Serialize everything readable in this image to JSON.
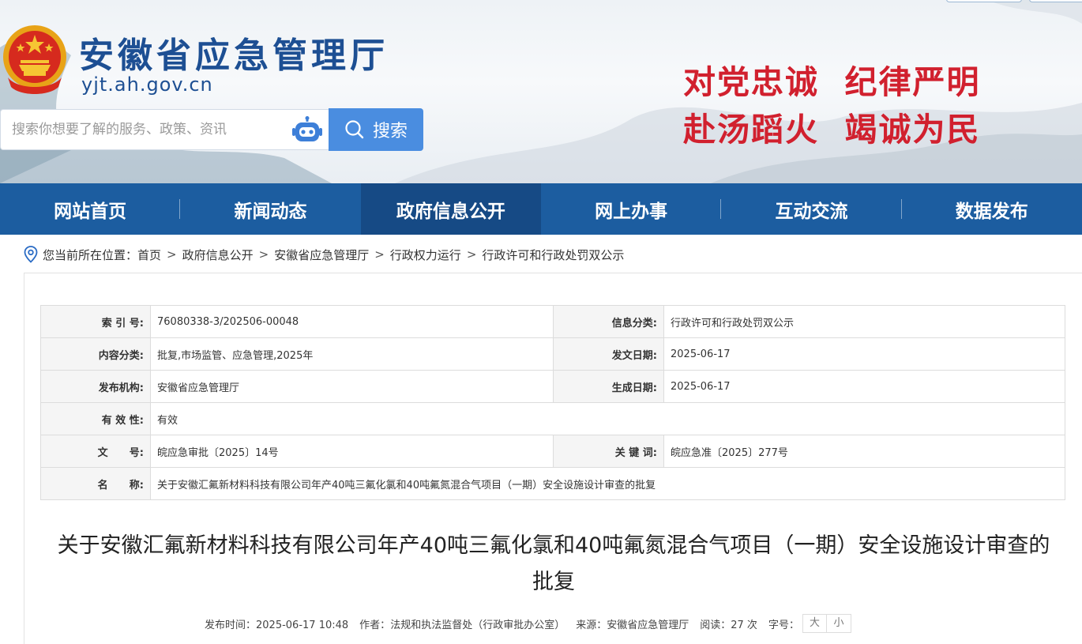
{
  "header": {
    "site_title": "安徽省应急管理厅",
    "site_domain": "yjt.ah.gov.cn",
    "slogan_line1": "对党忠诚  纪律严明",
    "slogan_line2": "赴汤蹈火  竭诚为民",
    "search_placeholder": "搜索你想要了解的服务、政策、资讯",
    "search_button": "搜索",
    "colors": {
      "title": "#1d4f93",
      "slogan": "#d1202e",
      "search_button": "#4a8de0"
    }
  },
  "nav": {
    "items": [
      {
        "label": "网站首页"
      },
      {
        "label": "新闻动态"
      },
      {
        "label": "政府信息公开"
      },
      {
        "label": "网上办事"
      },
      {
        "label": "互动交流"
      },
      {
        "label": "数据发布"
      }
    ],
    "active_label": "政府信息公开",
    "colors": {
      "bar": "#1c5da0",
      "active": "#164a85"
    }
  },
  "breadcrumb": {
    "prefix": "您当前所在位置：",
    "items": [
      "首页",
      "政府信息公开",
      "安徽省应急管理厅",
      "行政权力运行",
      "行政许可和行政处罚双公示"
    ],
    "separator": ">"
  },
  "meta": {
    "index_no_label": "索 引 号:",
    "index_no": "76080338-3/202506-00048",
    "info_category_label": "信息分类:",
    "info_category": "行政许可和行政处罚双公示",
    "content_category_label": "内容分类:",
    "content_category": "批复,市场监管、应急管理,2025年",
    "issue_date_label": "发文日期:",
    "issue_date": "2025-06-17",
    "publisher_label": "发布机构:",
    "publisher": "安徽省应急管理厅",
    "generated_date_label": "生成日期:",
    "generated_date": "2025-06-17",
    "validity_label": "有 效 性:",
    "validity": "有效",
    "doc_no_label": "文      号:",
    "doc_no": "皖应急审批〔2025〕14号",
    "keywords_label": "关 键 词:",
    "keywords": "皖应急准〔2025〕277号",
    "name_label": "名      称:",
    "name": "关于安徽汇氟新材料科技有限公司年产40吨三氟化氯和40吨氟氮混合气项目（一期）安全设施设计审查的批复"
  },
  "document": {
    "title_line1": "关于安徽汇氟新材料科技有限公司年产40吨三氟化氯和40吨氟氮混合气项目（一期）安全设施设计审查的",
    "title_line2": "批复",
    "publish_time_label": "发布时间：",
    "publish_time": "2025-06-17 10:48",
    "author_label": "作者：",
    "author": "法规和执法监督处（行政审批办公室）",
    "source_label": "来源：",
    "source": "安徽省应急管理厅",
    "reads_label": "阅读：",
    "reads": "27 次",
    "font_size_label": "字号：",
    "font_large": "大",
    "font_small": "小"
  }
}
